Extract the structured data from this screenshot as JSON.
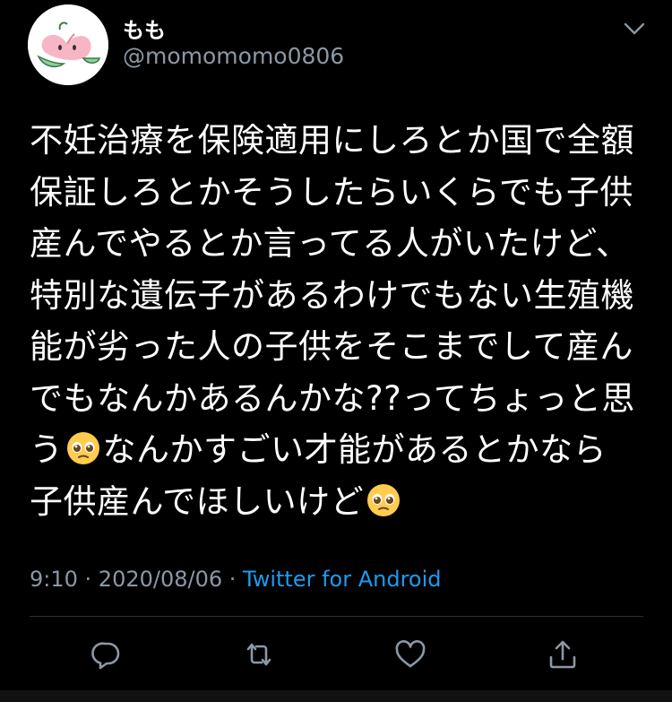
{
  "user": {
    "display_name": "もも",
    "handle": "@momomomo0806",
    "avatar_icon": "peach-avatar-icon"
  },
  "tweet": {
    "lines": [
      "不妊治療を保険適用にしろとか国で全額",
      "保証しろとかそうしたらいくらでも子供",
      "産んでやるとか言ってる人がいたけど、",
      "特別な遺伝子があるわけでもない生殖機",
      "能が劣った人の子供をそこまでして産ん",
      "でもなんかあるんかな??ってちょっと思",
      "う",
      "なんかすごい才能があるとかなら",
      "子供産んでほしいけど"
    ],
    "emoji": "pleading-face-icon"
  },
  "meta": {
    "time": "9:10",
    "sep1": " · ",
    "date": "2020/08/06",
    "sep2": " · ",
    "source": "Twitter for Android"
  },
  "actions": [
    "reply-icon",
    "retweet-icon",
    "like-icon",
    "share-icon"
  ],
  "colors": {
    "background": "#000000",
    "text": "#ffffff",
    "muted": "#8b98a5",
    "link": "#1d9bf0"
  }
}
